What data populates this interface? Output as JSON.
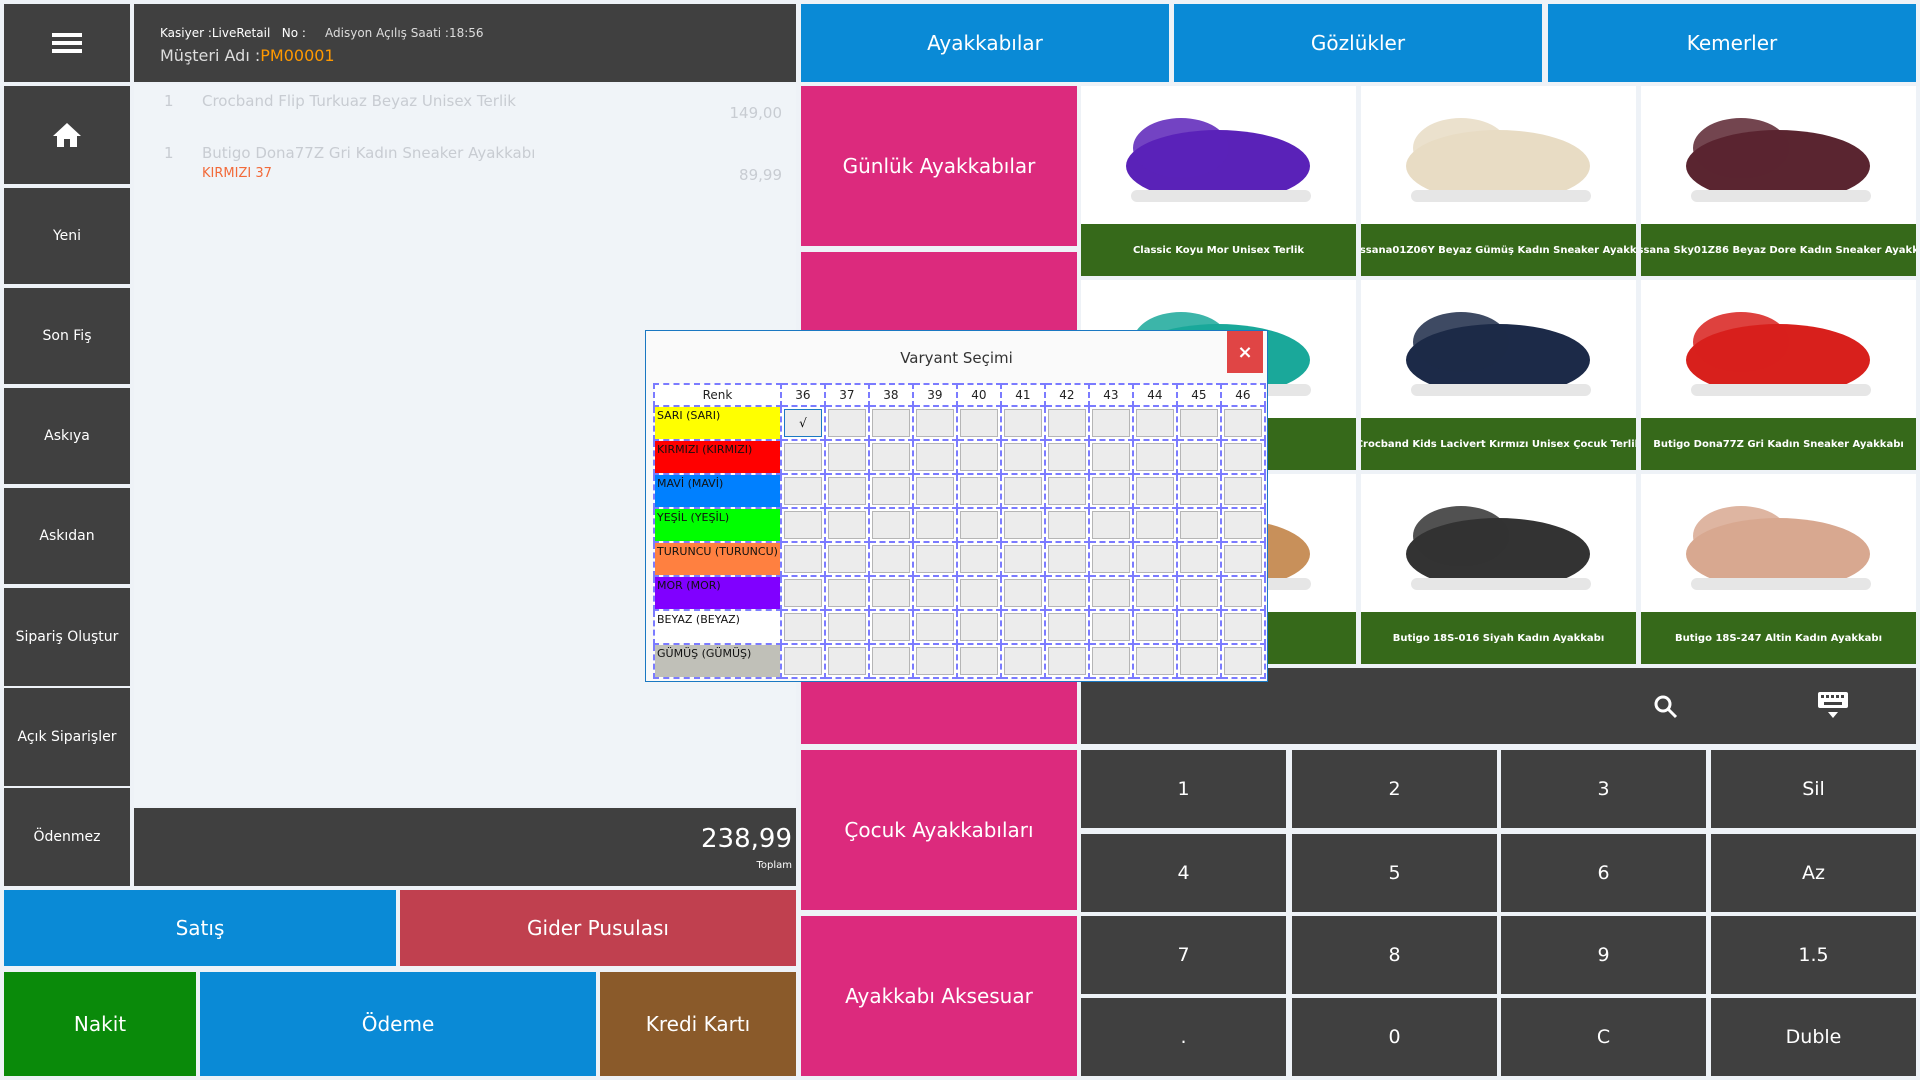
{
  "sidebar": {
    "items": [
      {
        "label": "",
        "icon": "hamburger-menu-icon"
      },
      {
        "label": "",
        "icon": "home-icon"
      },
      {
        "label": "Yeni"
      },
      {
        "label": "Son Fiş"
      },
      {
        "label": "Askıya"
      },
      {
        "label": "Askıdan"
      },
      {
        "label": "Sipariş Oluştur"
      },
      {
        "label": "Açık Siparişler"
      },
      {
        "label": "Ödenmez"
      }
    ]
  },
  "header": {
    "cashier": "Kasiyer :LiveRetail",
    "no": "No :",
    "opened": "Adisyon Açılış Saati :18:56",
    "customer_label": "Müşteri Adı :",
    "customer_value": "PM00001"
  },
  "order_lines": [
    {
      "qty": "1",
      "name": "Crocband Flip Turkuaz Beyaz Unisex Terlik",
      "variant": "",
      "price": "149,00"
    },
    {
      "qty": "1",
      "name": "Butigo Dona77Z Gri Kadın Sneaker Ayakkabı",
      "variant": "KIRMIZI 37",
      "price": "89,99"
    }
  ],
  "total": {
    "value": "238,99",
    "label": "Toplam"
  },
  "actions": {
    "sale": "Satış",
    "expense": "Gider Pusulası",
    "cash": "Nakit",
    "payment": "Ödeme",
    "card": "Kredi Kartı"
  },
  "top_categories": [
    "Ayakkabılar",
    "Gözlükler",
    "Kemerler"
  ],
  "sub_categories": [
    "Günlük Ayakkabılar",
    "",
    "",
    "",
    "Çocuk Ayakkabıları",
    "Ayakkabı Aksesuar"
  ],
  "products": [
    "Classic Koyu Mor Unisex Terlik",
    "Massana01Z06Y Beyaz Gümüş Kadın Sneaker Ayakkabı",
    "Massana Sky01Z86 Beyaz Dore Kadın Sneaker Ayakkabı",
    "isex Terlik",
    "Crocband Kids Lacivert Kırmızı Unisex Çocuk Terlik",
    "Butigo Dona77Z Gri Kadın Sneaker Ayakkabı",
    "andalet",
    "Butigo 18S-016 Siyah Kadın Ayakkabı",
    "Butigo 18S-247 Altin Kadın Ayakkabı"
  ],
  "product_colors": [
    "#5a22b8",
    "#e8dcc4",
    "#5a2530",
    "#1aa89a",
    "#1c2a48",
    "#d8201c",
    "#c8905a",
    "#333333",
    "#d8a890"
  ],
  "numpad": [
    "1",
    "2",
    "3",
    "Sil",
    "4",
    "5",
    "6",
    "Az",
    "7",
    "8",
    "9",
    "1.5",
    ".",
    "0",
    "C",
    "Duble"
  ],
  "dialog": {
    "title": "Varyant Seçimi",
    "close": "×",
    "color_header": "Renk",
    "sizes": [
      "36",
      "37",
      "38",
      "39",
      "40",
      "41",
      "42",
      "43",
      "44",
      "45",
      "46"
    ],
    "colors": [
      {
        "label": "SARI (SARI)",
        "hex": "#ffff00"
      },
      {
        "label": "KIRMIZI (KIRMIZI)",
        "hex": "#ff0000"
      },
      {
        "label": "MAVİ (MAVİ)",
        "hex": "#0080ff"
      },
      {
        "label": "YEŞİL (YEŞİL)",
        "hex": "#00ff00"
      },
      {
        "label": "TURUNCU (TURUNCU)",
        "hex": "#ff8040"
      },
      {
        "label": "MOR (MOR)",
        "hex": "#8000ff"
      },
      {
        "label": "BEYAZ (BEYAZ)",
        "hex": "#ffffff"
      },
      {
        "label": "GÜMÜŞ (GÜMÜŞ)",
        "hex": "#c0c0b8"
      }
    ],
    "checked": {
      "row": 0,
      "col": 0,
      "mark": "√"
    }
  },
  "theme": {
    "dark": "#404040",
    "blue": "#0a8ad6",
    "pink": "#dc2a7d",
    "accent": "#ff9900",
    "green": "#36691a"
  }
}
